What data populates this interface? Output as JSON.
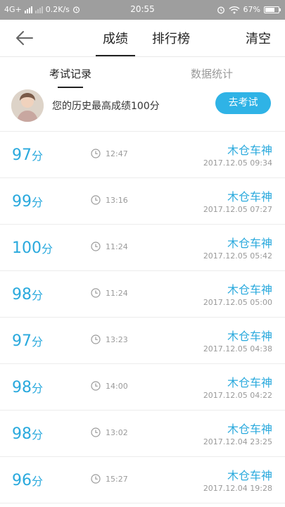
{
  "status_bar": {
    "network": "4G+",
    "speed": "0.2K/s",
    "time": "20:55",
    "battery": "67%"
  },
  "nav": {
    "tabs": [
      {
        "label": "成绩"
      },
      {
        "label": "排行榜"
      }
    ],
    "clear_label": "清空"
  },
  "subtabs": [
    {
      "label": "考试记录"
    },
    {
      "label": "数据统计"
    }
  ],
  "best": {
    "text": "您的历史最高成绩100分",
    "button_label": "去考试"
  },
  "records": [
    {
      "score": "97",
      "unit": "分",
      "duration": "12:47",
      "title": "木仓车神",
      "date": "2017.12.05  09:34"
    },
    {
      "score": "99",
      "unit": "分",
      "duration": "13:16",
      "title": "木仓车神",
      "date": "2017.12.05  07:27"
    },
    {
      "score": "100",
      "unit": "分",
      "duration": "11:24",
      "title": "木仓车神",
      "date": "2017.12.05  05:42"
    },
    {
      "score": "98",
      "unit": "分",
      "duration": "11:24",
      "title": "木仓车神",
      "date": "2017.12.05  05:00"
    },
    {
      "score": "97",
      "unit": "分",
      "duration": "13:23",
      "title": "木仓车神",
      "date": "2017.12.05  04:38"
    },
    {
      "score": "98",
      "unit": "分",
      "duration": "14:00",
      "title": "木仓车神",
      "date": "2017.12.05  04:22"
    },
    {
      "score": "98",
      "unit": "分",
      "duration": "13:02",
      "title": "木仓车神",
      "date": "2017.12.04  23:25"
    },
    {
      "score": "96",
      "unit": "分",
      "duration": "15:27",
      "title": "木仓车神",
      "date": "2017.12.04  19:28"
    }
  ],
  "colors": {
    "accent": "#2fb3e6",
    "score_text": "#29a9dd",
    "status_bar": "#9e9e9e"
  }
}
